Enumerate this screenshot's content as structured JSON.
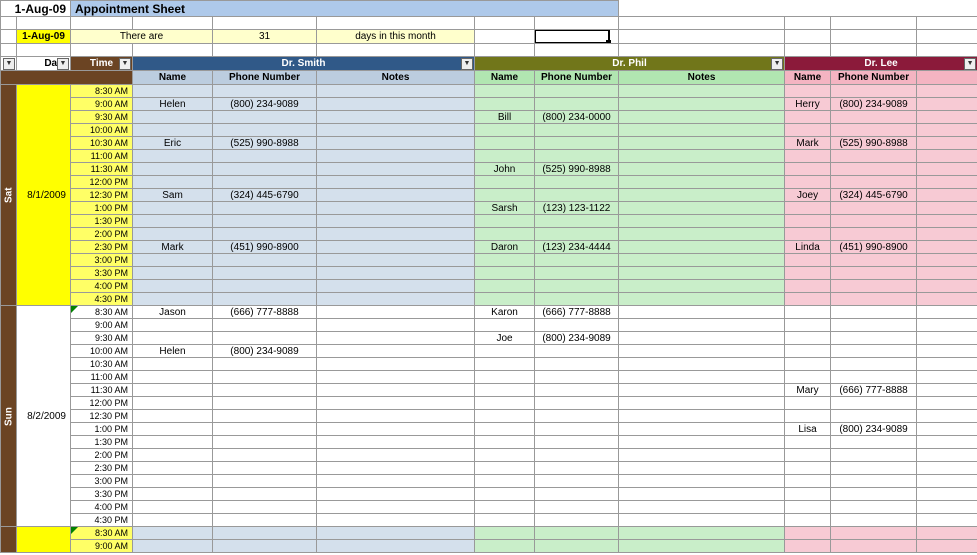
{
  "title_date": "1-Aug-09",
  "title": "Appointment Sheet",
  "info": {
    "date": "1-Aug-09",
    "there_are": "There are",
    "days_count": "31",
    "days_text": "days in this month"
  },
  "filters": {
    "date": "Date",
    "time": "Time"
  },
  "doctors": {
    "dr1": {
      "name": "Dr. Smith",
      "cols": [
        "Name",
        "Phone Number",
        "Notes"
      ]
    },
    "dr2": {
      "name": "Dr. Phil",
      "cols": [
        "Name",
        "Phone Number",
        "Notes"
      ]
    },
    "dr3": {
      "name": "Dr. Lee",
      "cols": [
        "Name",
        "Phone Number"
      ]
    }
  },
  "days": {
    "sat": {
      "label": "Sat",
      "date": "8/1/2009"
    },
    "sun": {
      "label": "Sun",
      "date": "8/2/2009"
    }
  },
  "times": [
    "8:30 AM",
    "9:00 AM",
    "9:30 AM",
    "10:00 AM",
    "10:30 AM",
    "11:00 AM",
    "11:30 AM",
    "12:00 PM",
    "12:30 PM",
    "1:00 PM",
    "1:30 PM",
    "2:00 PM",
    "2:30 PM",
    "3:00 PM",
    "3:30 PM",
    "4:00 PM",
    "4:30 PM"
  ],
  "next_times": [
    "8:30 AM",
    "9:00 AM"
  ],
  "appts": {
    "sat": {
      "dr1": {
        "9:00 AM": {
          "name": "Helen",
          "phone": "(800) 234-9089"
        },
        "10:30 AM": {
          "name": "Eric",
          "phone": "(525) 990-8988"
        },
        "12:30 PM": {
          "name": "Sam",
          "phone": "(324) 445-6790"
        },
        "2:30 PM": {
          "name": "Mark",
          "phone": "(451) 990-8900"
        }
      },
      "dr2": {
        "9:30 AM": {
          "name": "Bill",
          "phone": "(800) 234-0000"
        },
        "11:30 AM": {
          "name": "John",
          "phone": "(525) 990-8988"
        },
        "1:00 PM": {
          "name": "Sarsh",
          "phone": "(123) 123-1122"
        },
        "2:30 PM": {
          "name": "Daron",
          "phone": "(123) 234-4444"
        }
      },
      "dr3": {
        "9:00 AM": {
          "name": "Herry",
          "phone": "(800) 234-9089"
        },
        "10:30 AM": {
          "name": "Mark",
          "phone": "(525) 990-8988"
        },
        "12:30 PM": {
          "name": "Joey",
          "phone": "(324) 445-6790"
        },
        "2:30 PM": {
          "name": "Linda",
          "phone": "(451) 990-8900"
        }
      }
    },
    "sun": {
      "dr1": {
        "8:30 AM": {
          "name": "Jason",
          "phone": "(666) 777-8888"
        },
        "10:00 AM": {
          "name": "Helen",
          "phone": "(800) 234-9089"
        }
      },
      "dr2": {
        "8:30 AM": {
          "name": "Karon",
          "phone": "(666) 777-8888"
        },
        "9:30 AM": {
          "name": "Joe",
          "phone": "(800) 234-9089"
        }
      },
      "dr3": {
        "11:30 AM": {
          "name": "Mary",
          "phone": "(666) 777-8888"
        },
        "1:00 PM": {
          "name": "Lisa",
          "phone": "(800) 234-9089"
        }
      }
    }
  }
}
